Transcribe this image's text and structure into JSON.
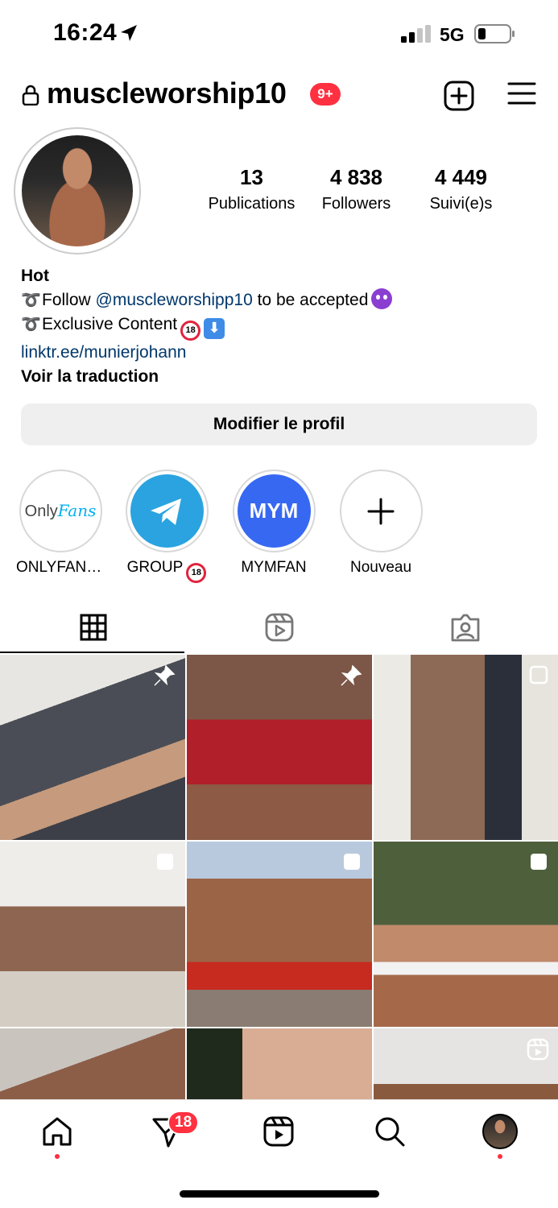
{
  "status_bar": {
    "time": "16:24",
    "network": "5G"
  },
  "header": {
    "username": "muscleworship10",
    "notification_badge": "9+"
  },
  "profile": {
    "stats": [
      {
        "value": "13",
        "label": "Publications"
      },
      {
        "value": "4 838",
        "label": "Followers"
      },
      {
        "value": "4 449",
        "label": "Suivi(e)s"
      }
    ],
    "bio": {
      "name": "Hot",
      "line1_prefix": "➰",
      "line1_text": "Follow ",
      "line1_mention": "@muscleworshipp10",
      "line1_suffix": " to be accepted",
      "line2_prefix": "➰",
      "line2_text": "Exclusive Content",
      "link": "linktr.ee/munierjohann",
      "translate": "Voir la traduction"
    },
    "edit_button": "Modifier le profil"
  },
  "highlights": [
    {
      "label": "ONLYFANS...",
      "logo_a": "Only",
      "logo_b": "Fans"
    },
    {
      "label": "GROUP"
    },
    {
      "label": "MYMFAN",
      "logo": "MYM"
    },
    {
      "label": "Nouveau"
    }
  ],
  "emoji": {
    "eighteen": "18",
    "down": "⬇"
  },
  "nav": {
    "dm_badge": "18"
  },
  "colors": {
    "accent_red": "#ff3040",
    "link": "#00376b",
    "telegram": "#2aa3e0",
    "mym": "#3768f2"
  }
}
